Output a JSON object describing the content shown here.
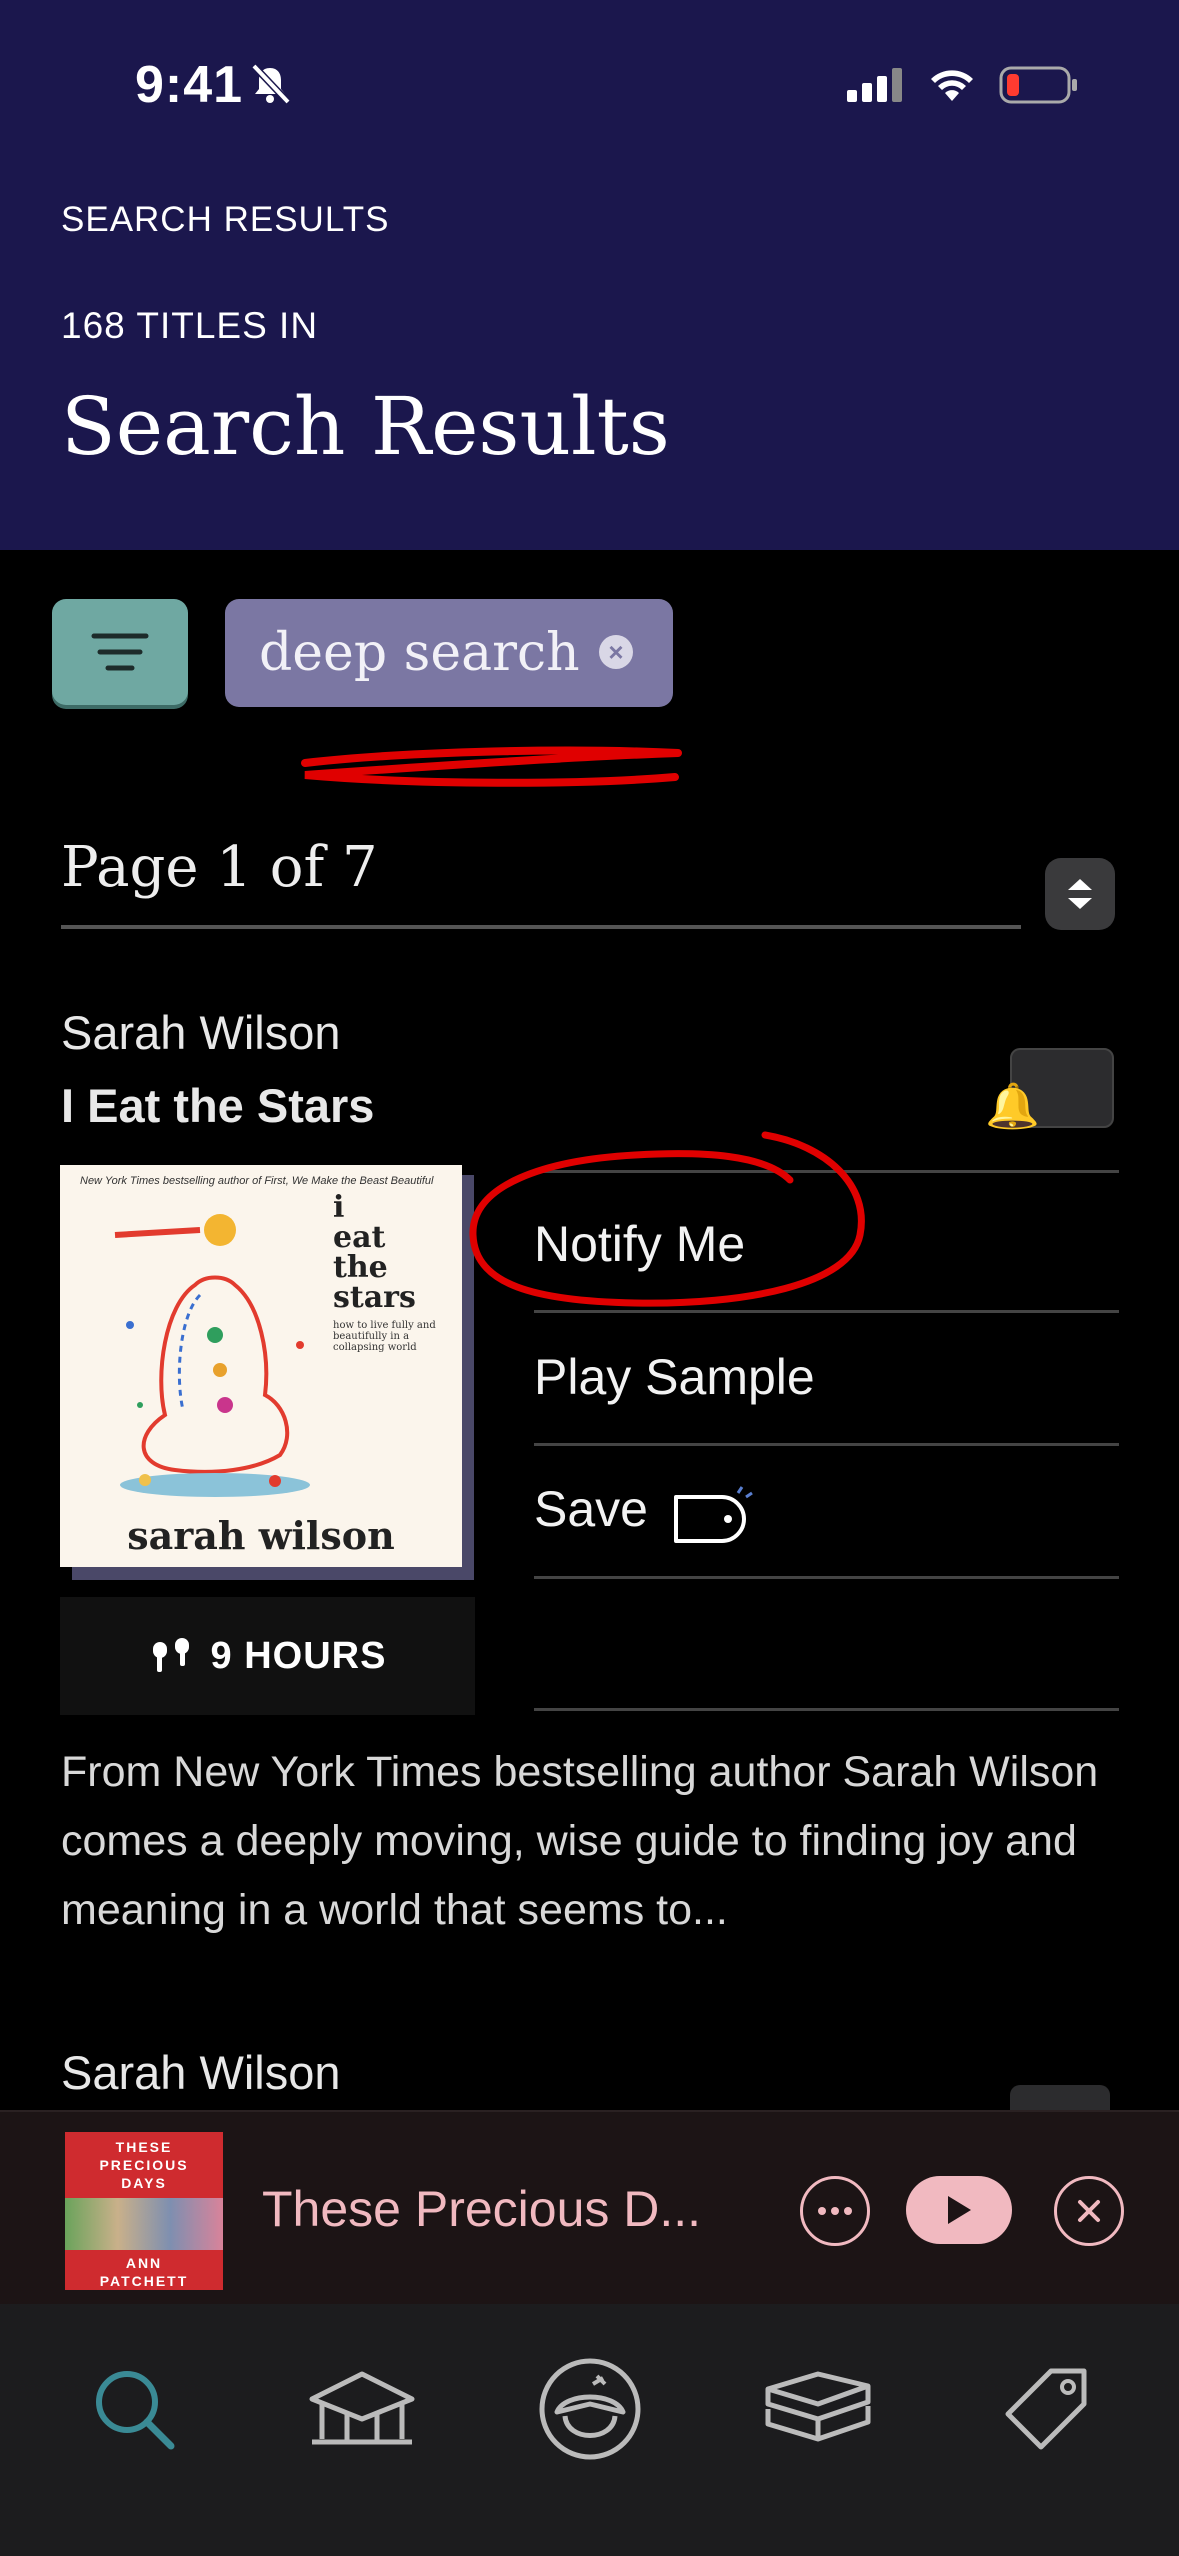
{
  "status": {
    "time": "9:41"
  },
  "header": {
    "section_label": "SEARCH RESULTS",
    "count_label": "168 TITLES IN",
    "title": "Search Results"
  },
  "filters": {
    "chip_label": "deep search"
  },
  "pager": {
    "label": "Page 1 of 7"
  },
  "results": [
    {
      "author": "Sarah Wilson",
      "title": "I Eat the Stars",
      "cover": {
        "top_line": "New York Times bestselling author of First, We Make the Beast Beautiful",
        "title_lines": [
          "i",
          "eat",
          "the",
          "stars"
        ],
        "subtitle": "how to live fully and beautifully in a collapsing world",
        "author": "sarah wilson"
      },
      "duration": "9 HOURS",
      "actions": [
        "Notify Me",
        "Play Sample",
        "Save"
      ],
      "description": "From New York Times bestselling author Sarah Wilson comes a deeply moving, wise guide to finding joy and meaning in a world that seems to..."
    },
    {
      "author": "Sarah Wilson"
    }
  ],
  "mini_player": {
    "title": "These Precious D...",
    "cover_lines": [
      "THESE",
      "PRECIOUS",
      "DAYS"
    ],
    "cover_author": [
      "ANN",
      "PATCHETT"
    ]
  },
  "tabbar": {
    "tabs": [
      "search-icon",
      "library-icon",
      "kids-icon",
      "shelf-icon",
      "tag-icon"
    ],
    "active_color": "#3a8a95"
  },
  "colors": {
    "header_bg": "#1b174d",
    "filter_button": "#6fa8a2",
    "chip_bg": "#7b77a3",
    "annotation_red": "#e00000",
    "player_accent": "#f1b9c0"
  }
}
